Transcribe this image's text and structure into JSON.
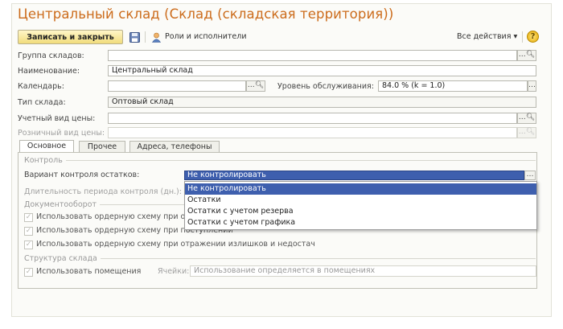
{
  "window": {
    "title": "Центральный склад (Склад (складская территория))"
  },
  "toolbar": {
    "save_close_label": "Записать и закрыть",
    "roles_label": "Роли и исполнители",
    "all_actions_label": "Все действия ▾",
    "help_label": "?",
    "icons": {
      "save": "floppy-disk-icon",
      "roles": "user-icon",
      "help": "help-icon"
    }
  },
  "fields": {
    "warehouse_group": {
      "label": "Группа складов:",
      "value": ""
    },
    "name": {
      "label": "Наименование:",
      "value": "Центральный склад"
    },
    "calendar": {
      "label": "Календарь:",
      "value": ""
    },
    "service_level": {
      "label": "Уровень обслуживания:",
      "value": "84.0 % (k = 1.0)"
    },
    "warehouse_type": {
      "label": "Тип склада:",
      "value": "Оптовый склад"
    },
    "accounting_price": {
      "label": "Учетный вид цены:",
      "value": ""
    },
    "retail_price": {
      "label": "Розничный вид цены:",
      "value": ""
    }
  },
  "tabs": [
    {
      "label": "Основное",
      "active": true
    },
    {
      "label": "Прочее",
      "active": false
    },
    {
      "label": "Адреса, телефоны",
      "active": false
    }
  ],
  "control": {
    "group_title": "Контроль",
    "stock_control_label": "Вариант контроля остатков:",
    "stock_control_value": "Не контролировать",
    "period_label": "Длительность периода контроля (дн.):",
    "options": [
      "Не контролировать",
      "Остатки",
      "Остатки с учетом резерва",
      "Остатки с учетом графика"
    ],
    "selected_index": 0
  },
  "docflow": {
    "group_title": "Документооборот",
    "checkboxes": [
      {
        "label": "Использовать ордерную схему при о",
        "checked": true
      },
      {
        "label": "Использовать ордерную схему при поступлении",
        "checked": true
      },
      {
        "label": "Использовать ордерную схему при отражении излишков и недостач",
        "checked": true
      }
    ]
  },
  "structure": {
    "group_title": "Структура склада",
    "use_rooms_label": "Использовать помещения",
    "use_rooms_checked": true,
    "cells_label": "Ячейки:",
    "cells_value": "Использование определяется в помещениях"
  },
  "colors": {
    "title": "#cc6c1c",
    "selection": "#3e5fae",
    "save_button": "#f1dc7c"
  }
}
